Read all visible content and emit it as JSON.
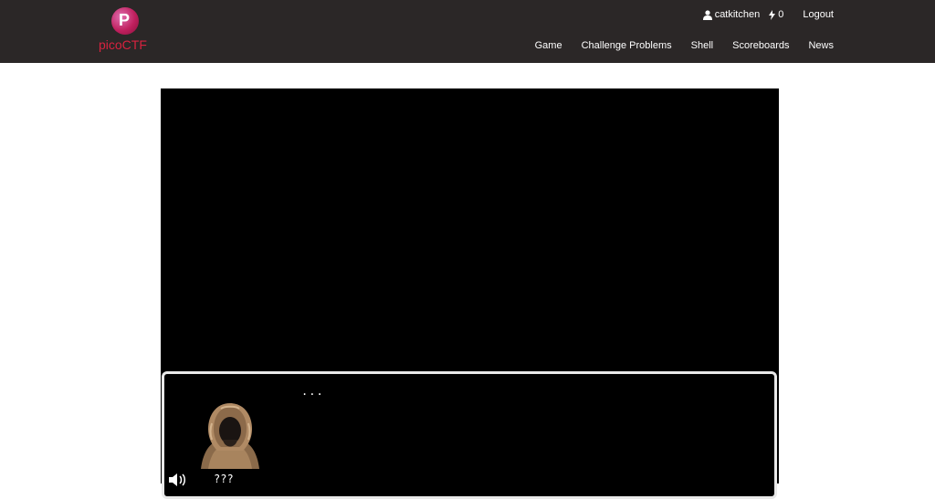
{
  "header": {
    "logo_text": "picoCTF",
    "user": {
      "username": "catkitchen",
      "score": "0",
      "logout_label": "Logout"
    },
    "nav": [
      {
        "label": "Game"
      },
      {
        "label": "Challenge Problems"
      },
      {
        "label": "Shell"
      },
      {
        "label": "Scoreboards"
      },
      {
        "label": "News"
      }
    ]
  },
  "game": {
    "dialog_text": "...",
    "speaker_name": "???",
    "portrait": "hooded-figure",
    "sound": "sound-on-icon"
  },
  "colors": {
    "topbar_bg": "#2b2727",
    "brand_red": "#d8223f",
    "game_bg": "#000000",
    "dialog_border": "#e9e9e9"
  }
}
